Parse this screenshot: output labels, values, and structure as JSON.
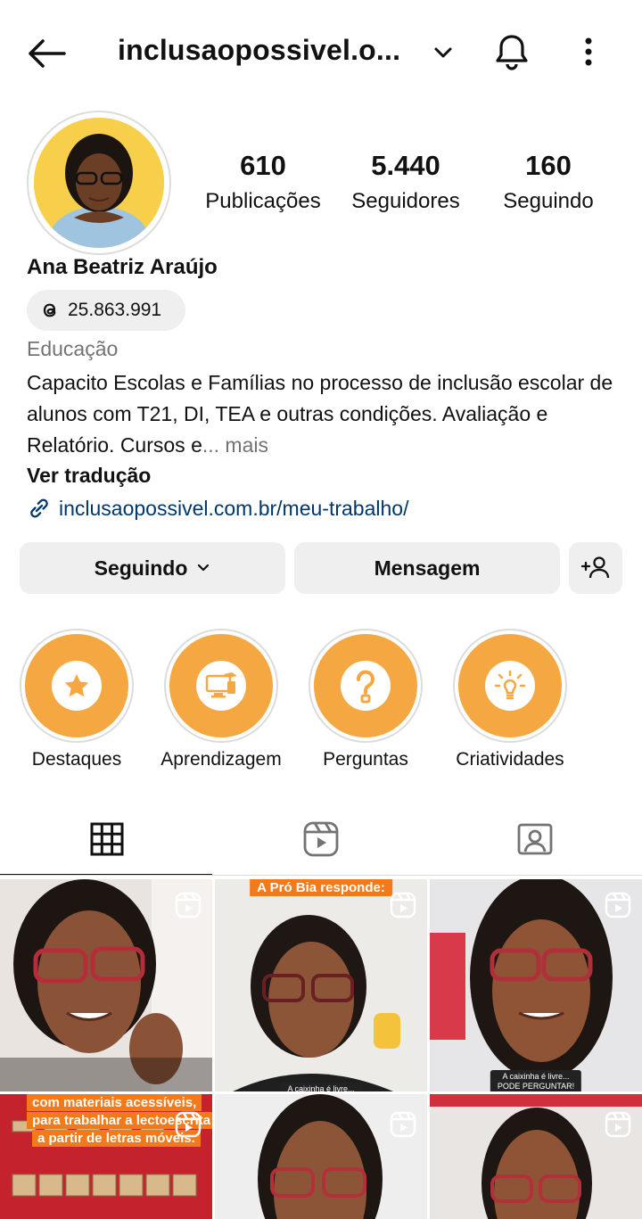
{
  "header": {
    "username": "inclusaopossivel.o...",
    "icons": [
      "back-arrow-icon",
      "chevron-down-icon",
      "bell-icon",
      "kebab-menu-icon"
    ]
  },
  "stats": [
    {
      "value": "610",
      "label": "Publicações"
    },
    {
      "value": "5.440",
      "label": "Seguidores"
    },
    {
      "value": "160",
      "label": "Seguindo"
    }
  ],
  "profile": {
    "name": "Ana Beatriz Araújo",
    "threads_count": "25.863.991",
    "category": "Educação",
    "bio": "Capacito Escolas e Famílias no processo de inclusão escolar de alunos com T21, DI, TEA e outras condições. Avaliação e Relatório. Cursos e",
    "bio_ellipsis": "... ",
    "more": "mais",
    "translate": "Ver tradução",
    "link": "inclusaopossivel.com.br/meu-trabalho/"
  },
  "actions": {
    "following": "Seguindo",
    "message": "Mensagem"
  },
  "highlights": [
    {
      "label": "Destaques",
      "icon": "star-icon"
    },
    {
      "label": "Aprendizagem",
      "icon": "computer-learning-icon"
    },
    {
      "label": "Perguntas",
      "icon": "question-mark-icon"
    },
    {
      "label": "Criatividades",
      "icon": "lightbulb-icon"
    }
  ],
  "tabs": [
    "grid-icon",
    "reels-icon",
    "tagged-icon"
  ],
  "posts": {
    "banner_2": "A Pró Bia responde:",
    "caption_2": "A caixinha é livre...",
    "caption_3a": "A caixinha é livre...",
    "caption_3b": "PODE PERGUNTAR!",
    "text_4a": "com materiais acessíveis,",
    "text_4b": "para trabalhar a lectoescrita",
    "text_4c": "a partir de letras móveis."
  },
  "colors": {
    "highlight": "#f5a742",
    "avatar_bg": "#f7cf4a",
    "link": "#00376b",
    "button_bg": "#efefef"
  }
}
